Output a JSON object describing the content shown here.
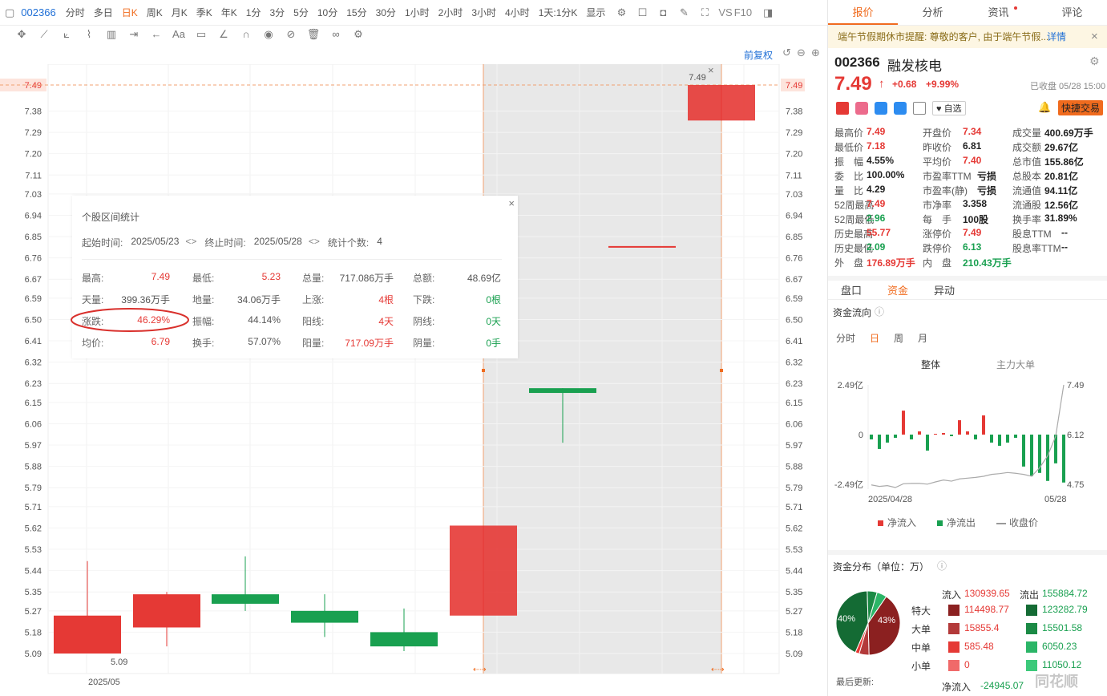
{
  "toolbar": {
    "symbol": "002366",
    "tabs": [
      "分时",
      "多日",
      "日K",
      "周K",
      "月K",
      "季K",
      "年K",
      "1分",
      "3分",
      "5分",
      "10分",
      "15分",
      "30分",
      "1小时",
      "2小时",
      "3小时",
      "4小时",
      "1天:1分K",
      "显示"
    ],
    "active_tab": "日K",
    "vs": "VS",
    "f10": "F10"
  },
  "chart": {
    "fuquan": "前复权",
    "current_price": "7.49",
    "y_ticks": [
      "7.49",
      "7.38",
      "7.29",
      "7.20",
      "7.11",
      "7.03",
      "6.94",
      "6.85",
      "6.76",
      "6.67",
      "6.59",
      "6.50",
      "6.41",
      "6.32",
      "6.23",
      "6.15",
      "6.06",
      "5.97",
      "5.88",
      "5.79",
      "5.71",
      "5.62",
      "5.53",
      "5.44",
      "5.35",
      "5.27",
      "5.18",
      "5.09"
    ],
    "low_label": "5.09",
    "high_label": "7.49",
    "x_label": "2025/05",
    "colors": {
      "up": "#e53935",
      "down": "#19a050",
      "select": "#e8e8e8"
    }
  },
  "chart_data": {
    "type": "candlestick",
    "ylim": [
      5.05,
      7.55
    ],
    "candles": [
      {
        "open": 5.09,
        "close": 5.25,
        "high": 5.48,
        "low": 5.09
      },
      {
        "open": 5.2,
        "close": 5.34,
        "high": 5.35,
        "low": 5.12
      },
      {
        "open": 5.34,
        "close": 5.3,
        "high": 5.5,
        "low": 5.27
      },
      {
        "open": 5.27,
        "close": 5.22,
        "high": 5.34,
        "low": 5.16
      },
      {
        "open": 5.18,
        "close": 5.12,
        "high": 5.28,
        "low": 5.1
      },
      {
        "open": 5.25,
        "close": 5.63,
        "high": 5.63,
        "low": 5.25
      },
      {
        "open": 6.21,
        "close": 6.19,
        "high": 6.21,
        "low": 5.98
      },
      {
        "open": 6.81,
        "close": 6.81,
        "high": 6.81,
        "low": 6.81
      },
      {
        "open": 7.34,
        "close": 7.49,
        "high": 7.49,
        "low": 7.34
      }
    ]
  },
  "stats": {
    "title": "个股区间统计",
    "start_label": "起始时间:",
    "start": "2025/05/23",
    "end_label": "终止时间:",
    "end": "2025/05/28",
    "count_label": "统计个数:",
    "count": "4",
    "rows": [
      [
        [
          "最高:",
          "7.49",
          "red"
        ],
        [
          "最低:",
          "5.23",
          "red"
        ],
        [
          "总量:",
          "717.086万手",
          "dark"
        ],
        [
          "总额:",
          "48.69亿",
          "dark"
        ]
      ],
      [
        [
          "天量:",
          "399.36万手",
          "dark"
        ],
        [
          "地量:",
          "34.06万手",
          "dark"
        ],
        [
          "上涨:",
          "4根",
          "red"
        ],
        [
          "下跌:",
          "0根",
          "green"
        ]
      ],
      [
        [
          "涨跌:",
          "46.29%",
          "red"
        ],
        [
          "振幅:",
          "44.14%",
          "dark"
        ],
        [
          "阳线:",
          "4天",
          "red"
        ],
        [
          "阴线:",
          "0天",
          "green"
        ]
      ],
      [
        [
          "均价:",
          "6.79",
          "red"
        ],
        [
          "换手:",
          "57.07%",
          "dark"
        ],
        [
          "阳量:",
          "717.09万手",
          "red"
        ],
        [
          "阴量:",
          "0手",
          "green"
        ]
      ]
    ]
  },
  "right": {
    "tabs": [
      "报价",
      "分析",
      "资讯",
      "评论"
    ],
    "notice": "端午节假期休市提醒: 尊敬的客户, 由于端午节假...",
    "notice_link": "详情",
    "code": "002366",
    "name": "融发核电",
    "price": "7.49",
    "change": "+0.68",
    "pct": "+9.99%",
    "closed": "已收盘 05/28 15:00",
    "watch": "自选",
    "fast_trade": "快捷交易",
    "quotes": [
      [
        [
          "最高价",
          "7.49",
          "red"
        ],
        [
          "开盘价",
          "7.34",
          "red"
        ],
        [
          "成交量",
          "400.69万手",
          "dark"
        ]
      ],
      [
        [
          "最低价",
          "7.18",
          "red"
        ],
        [
          "昨收价",
          "6.81",
          "dark"
        ],
        [
          "成交额",
          "29.67亿",
          "dark"
        ]
      ],
      [
        [
          "振　幅",
          "4.55%",
          "dark"
        ],
        [
          "平均价",
          "7.40",
          "red"
        ],
        [
          "总市值",
          "155.86亿",
          "dark"
        ]
      ],
      [
        [
          "委　比",
          "100.00%",
          "dark"
        ],
        [
          "市盈率TTM",
          "亏损",
          "dark"
        ],
        [
          "总股本",
          "20.81亿",
          "dark"
        ]
      ],
      [
        [
          "量　比",
          "4.29",
          "dark"
        ],
        [
          "市盈率(静)",
          "亏损",
          "dark"
        ],
        [
          "流通值",
          "94.11亿",
          "dark"
        ]
      ],
      [
        [
          "52周最高",
          "7.49",
          "red"
        ],
        [
          "市净率",
          "3.358",
          "dark"
        ],
        [
          "流通股",
          "12.56亿",
          "dark"
        ]
      ],
      [
        [
          "52周最低",
          "2.96",
          "green"
        ],
        [
          "每　手",
          "100股",
          "dark"
        ],
        [
          "换手率",
          "31.89%",
          "dark"
        ]
      ],
      [
        [
          "历史最高",
          "55.77",
          "red"
        ],
        [
          "涨停价",
          "7.49",
          "red"
        ],
        [
          "股息TTM",
          "--",
          "dark"
        ]
      ],
      [
        [
          "历史最低",
          "2.09",
          "green"
        ],
        [
          "跌停价",
          "6.13",
          "green"
        ],
        [
          "股息率TTM",
          "--",
          "dark"
        ]
      ],
      [
        [
          "外　盘",
          "176.89万手",
          "red"
        ],
        [
          "内　盘",
          "210.43万手",
          "green"
        ],
        [
          "",
          "",
          "dark"
        ]
      ]
    ],
    "subtabs": [
      "盘口",
      "资金",
      "异动"
    ],
    "active_subtab": "资金",
    "flow_title": "资金流向",
    "periods": [
      "分时",
      "日",
      "周",
      "月"
    ],
    "active_period": "日",
    "flow_types": [
      "整体",
      "主力大单"
    ],
    "flow_y_left": [
      "2.49亿",
      "0",
      "-2.49亿"
    ],
    "flow_y_right": [
      "7.49",
      "6.12",
      "4.75"
    ],
    "flow_x": [
      "2025/04/28",
      "05/28"
    ],
    "legend": [
      "净流入",
      "净流出",
      "收盘价"
    ],
    "dist_title": "资金分布（单位：万）",
    "pie_labels": [
      "40%",
      "43%"
    ],
    "dist_headers": [
      "流入",
      "130939.65",
      "流出",
      "155884.72"
    ],
    "dist_rows": [
      [
        "特大",
        "114498.77",
        "123282.79"
      ],
      [
        "大单",
        "15855.4",
        "15501.58"
      ],
      [
        "中单",
        "585.48",
        "6050.23"
      ],
      [
        "小单",
        "0",
        "11050.12"
      ]
    ],
    "last_update": "最后更新:",
    "net_label": "净流入",
    "net_value": "-24945.07",
    "watermark": "同花顺"
  },
  "flow_chart_data": {
    "type": "bar",
    "values": [
      -0.3,
      -0.9,
      -0.5,
      -0.2,
      1.5,
      -0.3,
      0.2,
      -1.0,
      0.05,
      0.1,
      -0.1,
      0.9,
      0.2,
      -0.3,
      1.2,
      -0.5,
      -0.7,
      -0.5,
      -0.2,
      -2.0,
      -2.6,
      -2.4,
      -2.9,
      -1.8,
      -3.0
    ],
    "closes": [
      4.82,
      4.78,
      4.8,
      4.75,
      4.85,
      4.86,
      4.86,
      4.84,
      4.9,
      4.95,
      4.92,
      4.98,
      5.0,
      5.02,
      5.05,
      5.1,
      5.12,
      5.15,
      5.13,
      5.1,
      5.05,
      5.28,
      5.6,
      6.12,
      7.49
    ]
  }
}
